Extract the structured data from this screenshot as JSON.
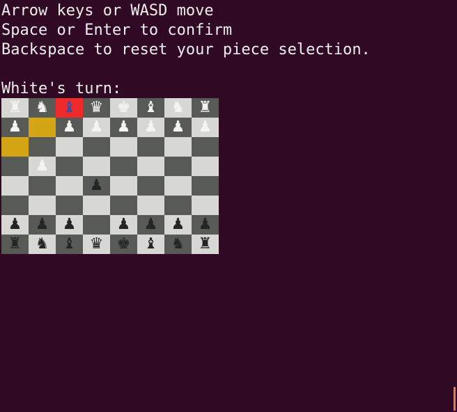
{
  "instructions": [
    "Arrow keys or WASD move",
    "Space or Enter to confirm",
    "Backspace to reset your piece selection."
  ],
  "turn_text": "White's turn:",
  "board": {
    "ranks": [
      [
        {
          "p": "♜",
          "c": "white"
        },
        {
          "p": "♞",
          "c": "white"
        },
        {
          "p": "♝",
          "c": "white",
          "cursor": true
        },
        {
          "p": "♛",
          "c": "white"
        },
        {
          "p": "♚",
          "c": "white"
        },
        {
          "p": "♝",
          "c": "white"
        },
        {
          "p": "♞",
          "c": "white"
        },
        {
          "p": "♜",
          "c": "white"
        }
      ],
      [
        {
          "p": "♟",
          "c": "white"
        },
        {
          "p": "",
          "c": "",
          "selected": true
        },
        {
          "p": "♟",
          "c": "white"
        },
        {
          "p": "♟",
          "c": "white"
        },
        {
          "p": "♟",
          "c": "white"
        },
        {
          "p": "♟",
          "c": "white"
        },
        {
          "p": "♟",
          "c": "white"
        },
        {
          "p": "♟",
          "c": "white"
        }
      ],
      [
        {
          "p": "",
          "c": "",
          "selected": true
        },
        {
          "p": "",
          "c": ""
        },
        {
          "p": "",
          "c": ""
        },
        {
          "p": "",
          "c": ""
        },
        {
          "p": "",
          "c": ""
        },
        {
          "p": "",
          "c": ""
        },
        {
          "p": "",
          "c": ""
        },
        {
          "p": "",
          "c": ""
        }
      ],
      [
        {
          "p": "",
          "c": ""
        },
        {
          "p": "♟",
          "c": "white"
        },
        {
          "p": "",
          "c": ""
        },
        {
          "p": "",
          "c": ""
        },
        {
          "p": "",
          "c": ""
        },
        {
          "p": "",
          "c": ""
        },
        {
          "p": "",
          "c": ""
        },
        {
          "p": "",
          "c": ""
        }
      ],
      [
        {
          "p": "",
          "c": ""
        },
        {
          "p": "",
          "c": ""
        },
        {
          "p": "",
          "c": ""
        },
        {
          "p": "♟",
          "c": "black"
        },
        {
          "p": "",
          "c": ""
        },
        {
          "p": "",
          "c": ""
        },
        {
          "p": "",
          "c": ""
        },
        {
          "p": "",
          "c": ""
        }
      ],
      [
        {
          "p": "",
          "c": ""
        },
        {
          "p": "",
          "c": ""
        },
        {
          "p": "",
          "c": ""
        },
        {
          "p": "",
          "c": ""
        },
        {
          "p": "",
          "c": ""
        },
        {
          "p": "",
          "c": ""
        },
        {
          "p": "",
          "c": ""
        },
        {
          "p": "",
          "c": ""
        }
      ],
      [
        {
          "p": "♟",
          "c": "black"
        },
        {
          "p": "♟",
          "c": "black"
        },
        {
          "p": "♟",
          "c": "black"
        },
        {
          "p": "",
          "c": ""
        },
        {
          "p": "♟",
          "c": "black"
        },
        {
          "p": "♟",
          "c": "black"
        },
        {
          "p": "♟",
          "c": "black"
        },
        {
          "p": "♟",
          "c": "black"
        }
      ],
      [
        {
          "p": "♜",
          "c": "black"
        },
        {
          "p": "♞",
          "c": "black"
        },
        {
          "p": "♝",
          "c": "black"
        },
        {
          "p": "♛",
          "c": "black"
        },
        {
          "p": "♚",
          "c": "black"
        },
        {
          "p": "♝",
          "c": "black"
        },
        {
          "p": "♞",
          "c": "black"
        },
        {
          "p": "♜",
          "c": "black"
        }
      ]
    ]
  },
  "colors": {
    "background": "#300a24",
    "light_square": "#d7d8d3",
    "dark_square": "#585a55",
    "selection": "#d4a514",
    "cursor": "#ef2929"
  }
}
